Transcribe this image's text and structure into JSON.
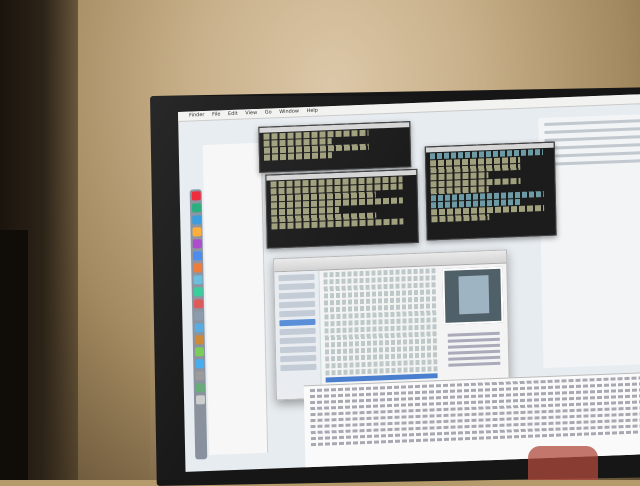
{
  "scene": {
    "description_colors": {
      "wall": "#c8b08a",
      "bezel": "#161616",
      "screen": "#e7ecf0",
      "terminal": "#1c1c1c",
      "selection": "#4a7fd0"
    }
  },
  "menubar": {
    "apple": "",
    "items": [
      "Finder",
      "File",
      "Edit",
      "View",
      "Go",
      "Window",
      "Help"
    ]
  }
}
